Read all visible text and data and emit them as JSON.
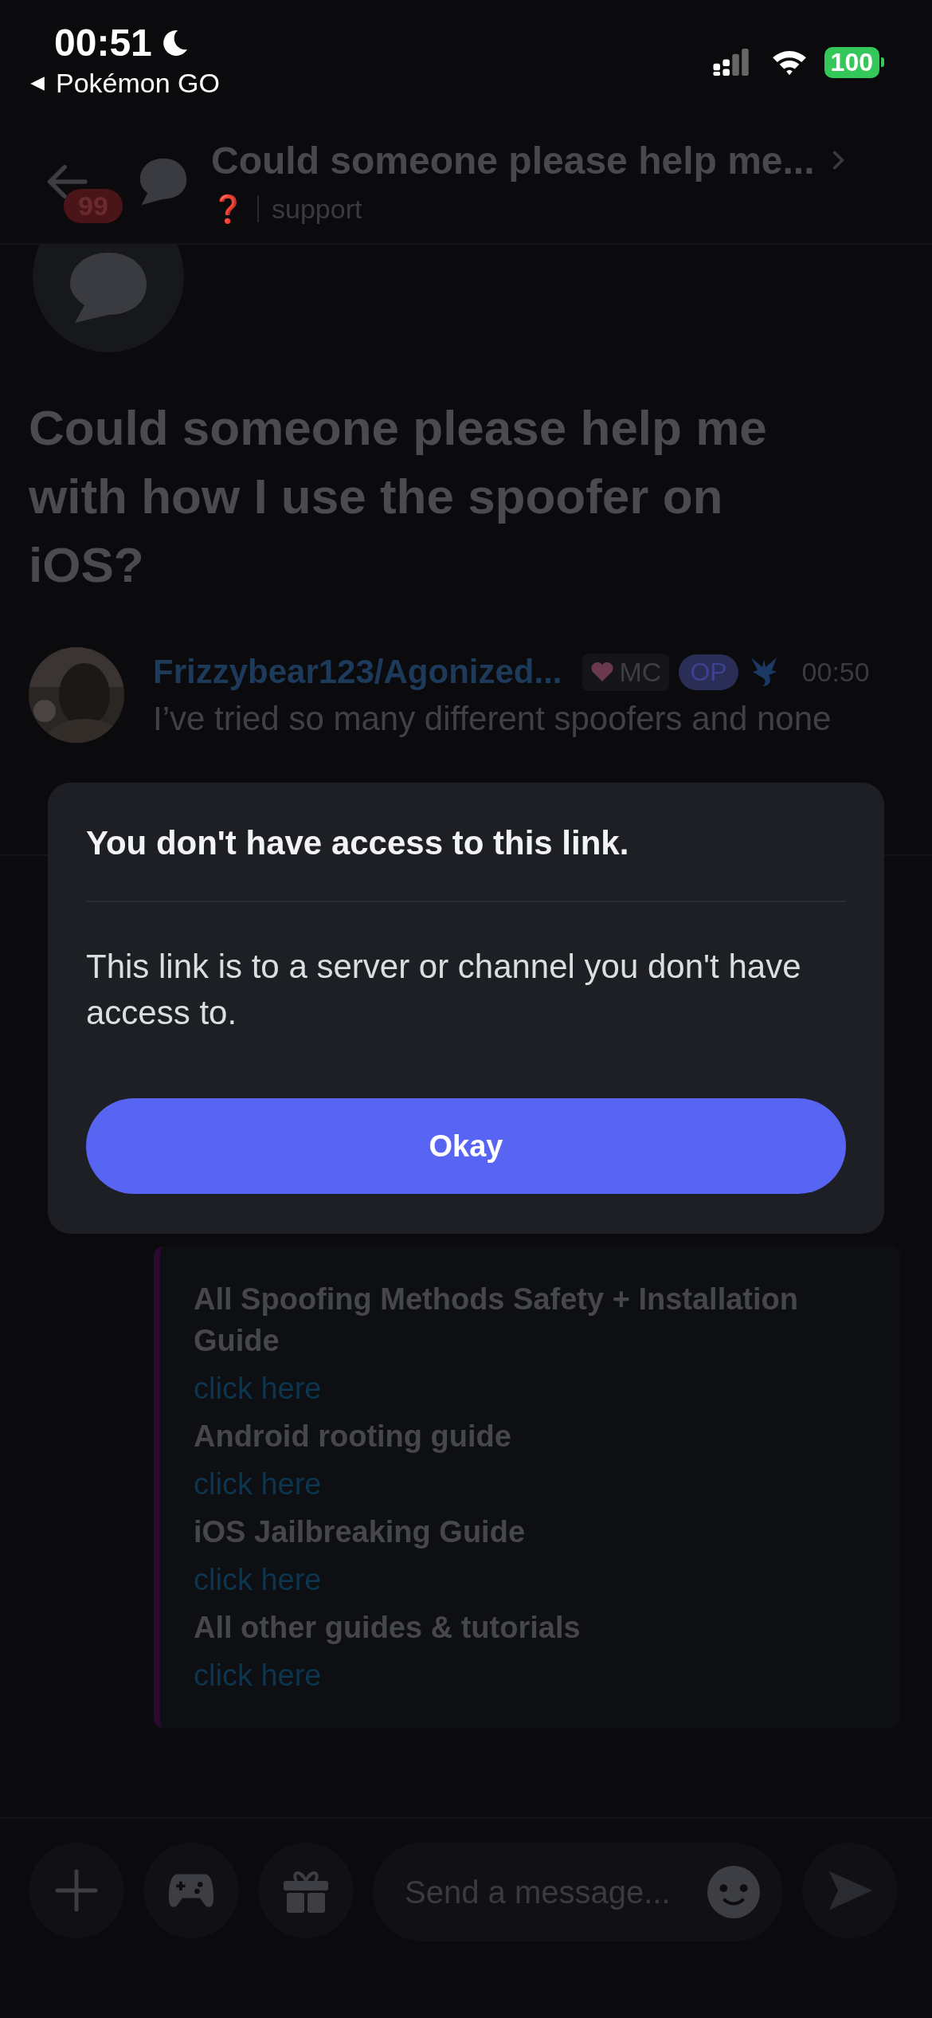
{
  "status_bar": {
    "time": "00:51",
    "back_app": "Pokémon GO",
    "battery": "100"
  },
  "header": {
    "unread_count": "99",
    "title": "Could someone please help me...",
    "tag": "❓",
    "channel": "support"
  },
  "post": {
    "title": "Could someone please help me with how I use the spoofer on iOS?",
    "message": {
      "author": "Frizzybear123/Agonized...",
      "badges": [
        {
          "kind": "role",
          "label": "MC"
        },
        {
          "kind": "op",
          "label": "OP"
        }
      ],
      "time": "00:50",
      "text": "I’ve tried so many different spoofers and none"
    }
  },
  "embed": {
    "items": [
      {
        "heading": "All Spoofing Methods Safety + Installation Guide",
        "link": "click here"
      },
      {
        "heading": "Android rooting guide",
        "link": "click here"
      },
      {
        "heading": "iOS Jailbreaking Guide",
        "link": "click here"
      },
      {
        "heading": "All other guides & tutorials",
        "link": "click here"
      }
    ]
  },
  "dialog": {
    "title": "You don't have access to this link.",
    "body": "This link is to a server or channel you don't have access to.",
    "button": "Okay"
  },
  "composer": {
    "placeholder": "Send a message..."
  }
}
